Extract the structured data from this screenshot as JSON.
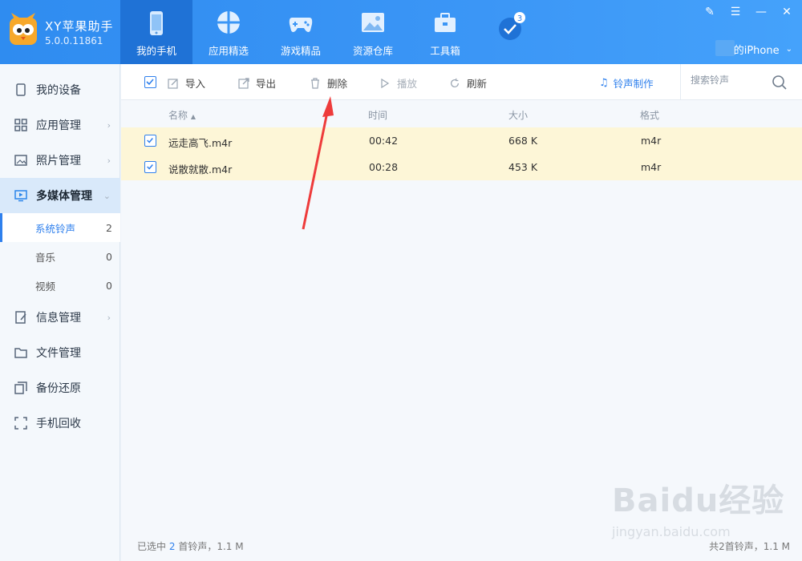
{
  "app": {
    "name": "XY苹果助手",
    "version": "5.0.0.11861"
  },
  "nav": [
    {
      "label": "我的手机",
      "icon": "phone-icon",
      "active": true
    },
    {
      "label": "应用精选",
      "icon": "apps-icon"
    },
    {
      "label": "游戏精品",
      "icon": "gamepad-icon"
    },
    {
      "label": "资源仓库",
      "icon": "image-icon"
    },
    {
      "label": "工具箱",
      "icon": "toolbox-icon"
    },
    {
      "label": "",
      "icon": "check-badge-icon",
      "badge": "3"
    }
  ],
  "device": {
    "name": "的iPhone"
  },
  "sidebar": {
    "items": [
      {
        "label": "我的设备",
        "icon": "device-icon"
      },
      {
        "label": "应用管理",
        "icon": "grid-icon",
        "chevron": "›"
      },
      {
        "label": "照片管理",
        "icon": "photo-icon",
        "chevron": "›"
      },
      {
        "label": "多媒体管理",
        "icon": "media-icon",
        "chevron": "⌄",
        "active": true
      },
      {
        "label": "信息管理",
        "icon": "message-icon",
        "chevron": "›"
      },
      {
        "label": "文件管理",
        "icon": "folder-icon"
      },
      {
        "label": "备份还原",
        "icon": "backup-icon"
      },
      {
        "label": "手机回收",
        "icon": "recycle-icon"
      }
    ],
    "sub": [
      {
        "label": "系统铃声",
        "count": "2",
        "active": true
      },
      {
        "label": "音乐",
        "count": "0"
      },
      {
        "label": "视频",
        "count": "0"
      }
    ]
  },
  "toolbar": {
    "import": "导入",
    "export": "导出",
    "delete": "删除",
    "play": "播放",
    "refresh": "刷新",
    "ringtone_make": "铃声制作",
    "search_placeholder": "搜索铃声"
  },
  "table": {
    "headers": {
      "name": "名称",
      "time": "时间",
      "size": "大小",
      "format": "格式"
    },
    "rows": [
      {
        "name": "远走高飞.m4r",
        "time": "00:42",
        "size": "668 K",
        "format": "m4r"
      },
      {
        "name": "说散就散.m4r",
        "time": "00:28",
        "size": "453 K",
        "format": "m4r"
      }
    ]
  },
  "footer": {
    "selected_prefix": "已选中",
    "selected_count": "2",
    "selected_suffix": "首铃声，1.1 M",
    "total": "共2首铃声，1.1 M"
  },
  "watermark": {
    "brand": "Baidu经验",
    "url": "jingyan.baidu.com"
  },
  "colors": {
    "accent": "#2f80ed",
    "header": "#3b96f6",
    "row_highlight": "#fdf6d7",
    "arrow": "#ee3b3b"
  }
}
